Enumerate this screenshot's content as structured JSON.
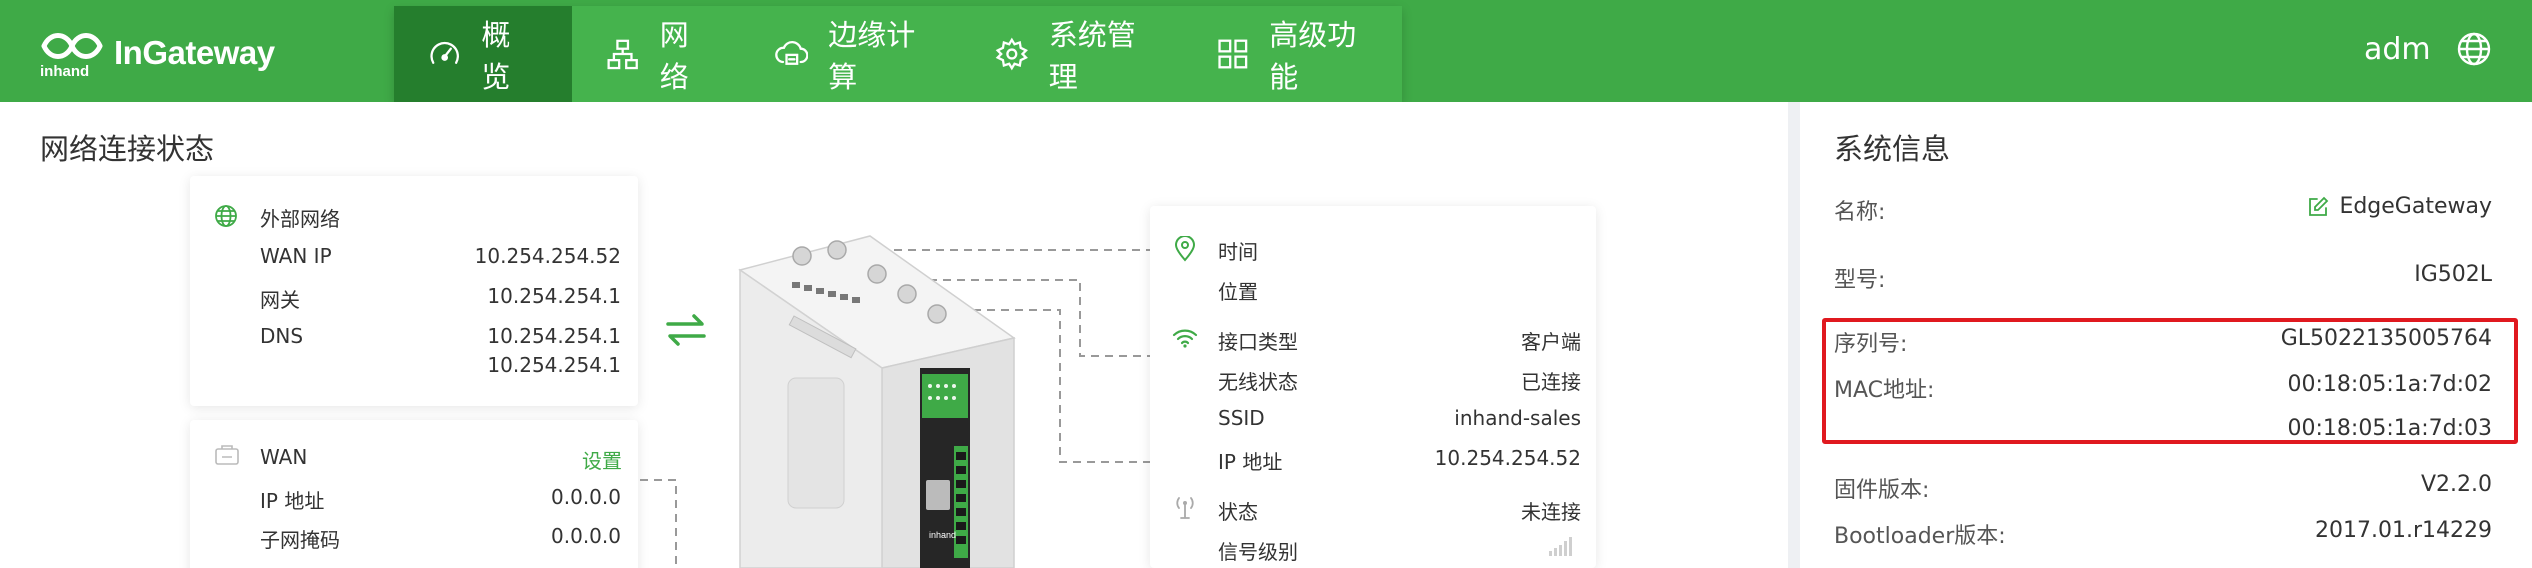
{
  "header": {
    "brand": "InGateway",
    "logo_text": "inhand",
    "user": "adm",
    "nav": [
      {
        "label": "概览",
        "icon": "dashboard-icon"
      },
      {
        "label": "网络",
        "icon": "network-icon"
      },
      {
        "label": "边缘计算",
        "icon": "edge-computing-icon"
      },
      {
        "label": "系统管理",
        "icon": "gear-icon"
      },
      {
        "label": "高级功能",
        "icon": "grid-icon"
      }
    ]
  },
  "network_status": {
    "title": "网络连接状态",
    "external": {
      "heading": "外部网络",
      "rows": [
        {
          "label": "WAN IP",
          "value": "10.254.254.52"
        },
        {
          "label": "网关",
          "value": "10.254.254.1"
        },
        {
          "label": "DNS",
          "value": "10.254.254.1"
        },
        {
          "label": "",
          "value": "10.254.254.1"
        }
      ]
    },
    "wan": {
      "heading": "WAN",
      "action": "设置",
      "rows": [
        {
          "label": "IP 地址",
          "value": "0.0.0.0"
        },
        {
          "label": "子网掩码",
          "value": "0.0.0.0"
        }
      ]
    },
    "time_card": {
      "time_label": "时间",
      "location_label": "位置",
      "rows": [
        {
          "label": "接口类型",
          "value": "客户端"
        },
        {
          "label": "无线状态",
          "value": "已连接"
        },
        {
          "label": "SSID",
          "value": "inhand-sales"
        },
        {
          "label": "IP 地址",
          "value": "10.254.254.52"
        },
        {
          "label": "状态",
          "value": "未连接"
        },
        {
          "label": "信号级别",
          "value": ""
        }
      ]
    }
  },
  "system_info": {
    "title": "系统信息",
    "name_label": "名称:",
    "name_value": "EdgeGateway",
    "model_label": "型号:",
    "model_value": "IG502L",
    "serial_label": "序列号:",
    "serial_value": "GL5022135005764",
    "mac_label": "MAC地址:",
    "mac_value_1": "00:18:05:1a:7d:02",
    "mac_value_2": "00:18:05:1a:7d:03",
    "firmware_label": "固件版本:",
    "firmware_value": "V2.2.0",
    "bootloader_label": "Bootloader版本:",
    "bootloader_value": "2017.01.r14229"
  },
  "colors": {
    "brand_green": "#3faa47",
    "active_nav": "#257e2d",
    "highlight_red": "#e0191f"
  }
}
